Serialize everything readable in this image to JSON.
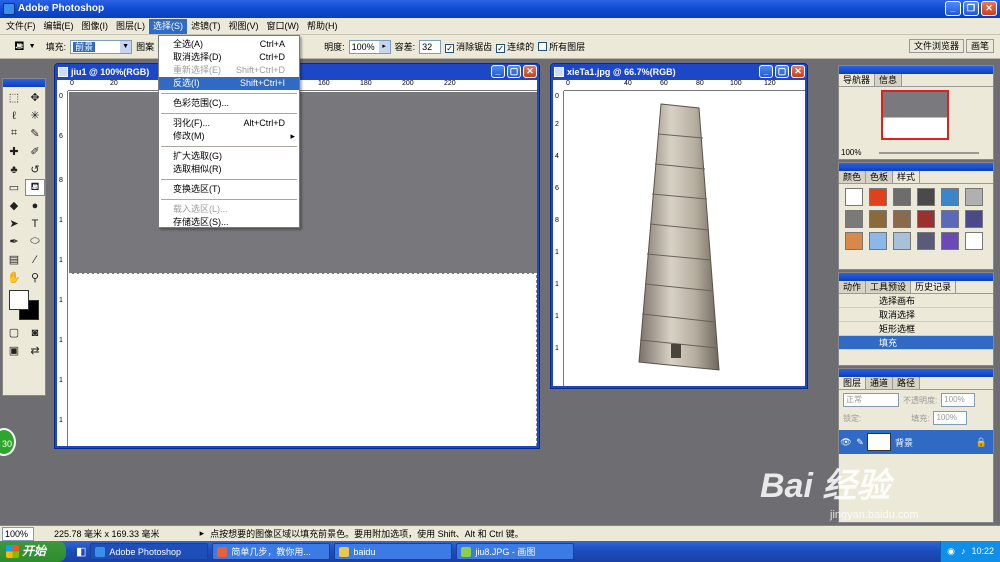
{
  "app": {
    "title": "Adobe Photoshop"
  },
  "menubar": {
    "items": [
      "文件(F)",
      "编辑(E)",
      "图像(I)",
      "图层(L)",
      "选择(S)",
      "滤镜(T)",
      "视图(V)",
      "窗口(W)",
      "帮助(H)"
    ]
  },
  "options": {
    "fill_label": "填充:",
    "fill_value": "前景",
    "pattern_label": "图案",
    "opacity_label": "明度:",
    "opacity_value": "100%",
    "tolerance_label": "容差:",
    "tolerance_value": "32",
    "antialias_label": "消除锯齿",
    "contiguous_label": "连续的",
    "all_layers_label": "所有图层",
    "tab_file_browser": "文件浏览器",
    "tab_brushes": "画笔"
  },
  "select_menu": {
    "items": [
      {
        "label": "全选(A)",
        "shortcut": "Ctrl+A",
        "state": "normal"
      },
      {
        "label": "取消选择(D)",
        "shortcut": "Ctrl+D",
        "state": "normal"
      },
      {
        "label": "重新选择(E)",
        "shortcut": "Shift+Ctrl+D",
        "state": "disabled"
      },
      {
        "label": "反选(I)",
        "shortcut": "Shift+Ctrl+I",
        "state": "highlighted"
      },
      {
        "sep": true
      },
      {
        "label": "色彩范围(C)...",
        "shortcut": "",
        "state": "normal"
      },
      {
        "sep": true
      },
      {
        "label": "羽化(F)...",
        "shortcut": "Alt+Ctrl+D",
        "state": "normal"
      },
      {
        "label": "修改(M)",
        "shortcut": "▸",
        "state": "normal"
      },
      {
        "sep": true
      },
      {
        "label": "扩大选取(G)",
        "shortcut": "",
        "state": "normal"
      },
      {
        "label": "选取相似(R)",
        "shortcut": "",
        "state": "normal"
      },
      {
        "sep": true
      },
      {
        "label": "变换选区(T)",
        "shortcut": "",
        "state": "normal"
      },
      {
        "sep": true
      },
      {
        "label": "载入选区(L)...",
        "shortcut": "",
        "state": "disabled"
      },
      {
        "label": "存储选区(S)...",
        "shortcut": "",
        "state": "normal"
      }
    ]
  },
  "doc1": {
    "title": "jiu1 @ 100%(RGB)",
    "ruler_ticks": [
      "0",
      "20",
      "140",
      "160",
      "180",
      "200",
      "220"
    ],
    "vruler": [
      "0",
      "6",
      "8",
      "1",
      "1",
      "1",
      "1",
      "1",
      "1"
    ]
  },
  "doc2": {
    "title": "xieTa1.jpg @ 66.7%(RGB)",
    "ruler_ticks": [
      "0",
      "40",
      "60",
      "80",
      "100",
      "120"
    ],
    "vruler": [
      "0",
      "2",
      "4",
      "6",
      "8",
      "1",
      "1",
      "1",
      "1"
    ]
  },
  "navigator": {
    "tab1": "导航器",
    "tab2": "信息",
    "zoom": "100%"
  },
  "swatch_palette": {
    "tabs": [
      "颜色",
      "色板",
      "样式"
    ],
    "colors": [
      "#ffffff",
      "#e0401a",
      "#6d6d6d",
      "#4a4a4a",
      "#3b86c8",
      "#b0b0b0",
      "#7a7a7a",
      "#8a6a3a",
      "#8a6a4a",
      "#9a3030",
      "#5a6ab8",
      "#4a4a8a",
      "#d8884a",
      "#8ab8e8",
      "#a8c0d8",
      "#5a5a7a",
      "#6a4ab8",
      "#ffffff"
    ]
  },
  "history": {
    "tabs": [
      "动作",
      "工具预设",
      "历史记录"
    ],
    "items": [
      "选择画布",
      "取消选择",
      "矩形选框",
      "填充"
    ]
  },
  "layers": {
    "tabs": [
      "图层",
      "通道",
      "路径"
    ],
    "blend_mode": "正常",
    "opacity_label": "不透明度:",
    "opacity_value": "100%",
    "lock_label": "锁定:",
    "fill_label": "填充:",
    "fill_value": "100%",
    "layer_name": "背景"
  },
  "status": {
    "zoom": "100%",
    "size": "225.78 毫米 x 169.33 毫米",
    "hint": "点按想要的图像区域以填充前景色。要用附加选项，使用 Shift、Alt 和 Ctrl 键。"
  },
  "taskbar": {
    "start": "开始",
    "tasks": [
      "Adobe Photoshop",
      "简单几步，教你用...",
      "baidu",
      "jiu8.JPG - 画图"
    ],
    "clock": "10:22"
  },
  "watermark": {
    "brand": "Bai 经验",
    "url": "jingyan.baidu.com"
  },
  "badge": {
    "value": "30"
  }
}
